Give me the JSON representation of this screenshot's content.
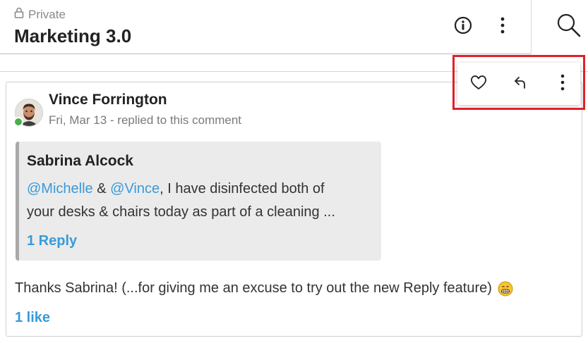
{
  "header": {
    "privacy_label": "Private",
    "title": "Marketing 3.0",
    "icons": [
      "lock-icon",
      "info-icon",
      "more-vertical-icon",
      "search-icon"
    ]
  },
  "comment": {
    "author": "Vince Forrington",
    "meta": "Fri, Mar 13 - replied to this comment",
    "presence": "online",
    "quoted": {
      "author": "Sabrina Alcock",
      "mention1": "@Michelle",
      "amp": "&",
      "mention2": "@Vince",
      "line1_rest": ", I have disinfected both of",
      "line2": "your desks & chairs today as part of a cleaning ...",
      "reply_count_label": "1 Reply"
    },
    "body": "Thanks Sabrina! (...for giving me an excuse to try out the new Reply feature)",
    "emoji": "grinning-face-emoji",
    "likes_label": "1 like"
  },
  "toolbar": {
    "actions": [
      "like-heart-icon",
      "reply-arrow-icon",
      "more-vertical-icon"
    ]
  },
  "colors": {
    "link": "#3a9ad9",
    "presence": "#47b04b",
    "highlight": "#e0202a",
    "quote_bg": "#ebebeb"
  }
}
